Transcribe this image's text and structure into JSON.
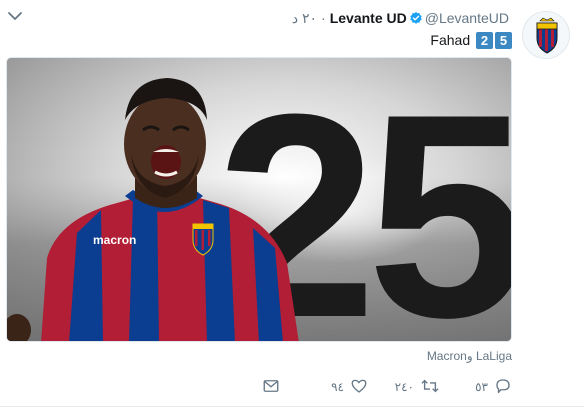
{
  "header": {
    "name": "Levante UD",
    "handle": "@LevanteUD",
    "dot": "·",
    "time": "٢٠ د"
  },
  "tweet": {
    "text": "Fahad",
    "numbers": [
      "2",
      "5"
    ]
  },
  "media": {
    "big_number": "25",
    "shirt_sponsor": "macron"
  },
  "tags": "Macronو LaLiga",
  "actions": {
    "reply_count": "٥٣",
    "retweet_count": "٢٤٠",
    "like_count": "٩٤"
  },
  "colors": {
    "verified": "#1da1f2",
    "numbox": "#3b88c3",
    "secondary_text": "#657786",
    "levante_blue": "#0b3d91",
    "levante_red": "#b21e35"
  },
  "icons": {
    "chevron": "chevron-down-icon",
    "verified": "verified-badge-icon",
    "reply": "reply-icon",
    "retweet": "retweet-icon",
    "like": "heart-icon",
    "dm": "direct-message-icon"
  }
}
